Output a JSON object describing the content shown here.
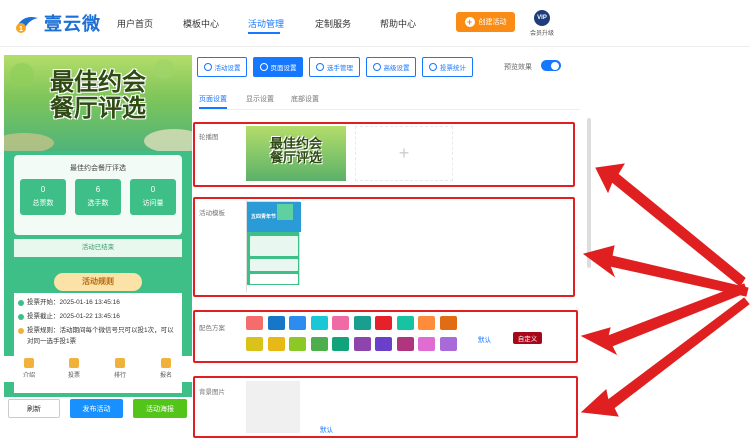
{
  "header": {
    "logo_text": "壹云微",
    "nav": [
      "用户首页",
      "模板中心",
      "活动管理",
      "定制服务",
      "帮助中心"
    ],
    "active_nav": "活动管理",
    "create_label": "创建活动",
    "vip_badge": "VIP",
    "vip_label": "会员升级"
  },
  "preview": {
    "banner_title_line1": "最佳约会",
    "banner_title_line2": "餐厅评选",
    "card_title": "最佳约会餐厅评选",
    "stats": [
      {
        "value": "0",
        "label": "总票数"
      },
      {
        "value": "6",
        "label": "选手数"
      },
      {
        "value": "0",
        "label": "访问量"
      }
    ],
    "status": "活动已结束",
    "rules_title": "活动规则",
    "rules": [
      "投票开始：2025-01-16 13:45:16",
      "投票截止：2025-01-22 13:45:16",
      "投票规则：活动期间每个微信号只可以投1次，可以对同一选手投1票"
    ],
    "bottom_nav": [
      "介绍",
      "投票",
      "排行",
      "报名"
    ]
  },
  "footer_buttons": {
    "refresh": "刷新",
    "publish": "发布活动",
    "poster": "活动海报"
  },
  "settings": {
    "tabs": [
      "活动设置",
      "页面设置",
      "选手管理",
      "高级设置",
      "投票统计"
    ],
    "active_tab": "页面设置",
    "toggle_label": "预览效果",
    "toggle_on": true,
    "subtabs": [
      "页面设置",
      "显示设置",
      "底部设置"
    ],
    "active_subtab": "页面设置",
    "carousel_label": "轮播图",
    "carousel_thumb_line1": "最佳约会",
    "carousel_thumb_line2": "餐厅评选",
    "template_label": "活动模板",
    "template_thumb_text": "五四青年节",
    "color_label": "配色方案",
    "colors_row1": [
      "#f56c6c",
      "#1677c9",
      "#2d8cf0",
      "#19c7d6",
      "#f06aa5",
      "#1a9e8f",
      "#e62129",
      "#17c3a0",
      "#ff8c3a",
      "#e06d14"
    ],
    "colors_row2": [
      "#d9c21a",
      "#e8b817",
      "#8ac926",
      "#4cae4c",
      "#12a37a",
      "#8e44ad",
      "#6a3fc9",
      "#b0347e",
      "#e06bd3",
      "#a86ad9"
    ],
    "default_label": "默认",
    "custom_label": "自定义",
    "bg_label": "背景图片",
    "bg_default_label": "默认"
  }
}
